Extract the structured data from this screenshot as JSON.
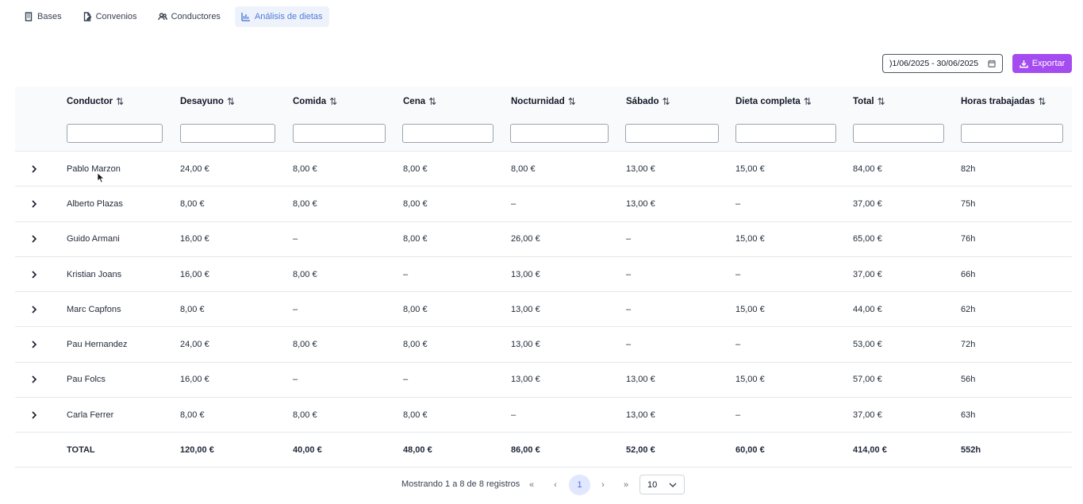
{
  "tabs": [
    {
      "label": "Bases",
      "icon": "building-icon",
      "active": false
    },
    {
      "label": "Convenios",
      "icon": "document-edit-icon",
      "active": false
    },
    {
      "label": "Conductores",
      "icon": "users-icon",
      "active": false
    },
    {
      "label": "Análisis de dietas",
      "icon": "bar-chart-icon",
      "active": true
    }
  ],
  "toolbar": {
    "date_range": ")1/06/2025 - 30/06/2025",
    "export_label": "Exportar",
    "accent_color": "#a54cf0"
  },
  "table": {
    "columns": [
      "Conductor",
      "Desayuno",
      "Comida",
      "Cena",
      "Nocturnidad",
      "Sábado",
      "Dieta completa",
      "Total",
      "Horas trabajadas"
    ],
    "sort_icon": "⇅",
    "rows": [
      [
        "Pablo Marzon",
        "24,00 €",
        "8,00 €",
        "8,00 €",
        "8,00 €",
        "13,00 €",
        "15,00 €",
        "84,00 €",
        "82h"
      ],
      [
        "Alberto Plazas",
        "8,00 €",
        "8,00 €",
        "8,00 €",
        "–",
        "13,00 €",
        "–",
        "37,00 €",
        "75h"
      ],
      [
        "Guido Armani",
        "16,00 €",
        "–",
        "8,00 €",
        "26,00 €",
        "–",
        "15,00 €",
        "65,00 €",
        "76h"
      ],
      [
        "Kristian Joans",
        "16,00 €",
        "8,00 €",
        "–",
        "13,00 €",
        "–",
        "–",
        "37,00 €",
        "66h"
      ],
      [
        "Marc Capfons",
        "8,00 €",
        "–",
        "8,00 €",
        "13,00 €",
        "–",
        "15,00 €",
        "44,00 €",
        "62h"
      ],
      [
        "Pau Hernandez",
        "24,00 €",
        "8,00 €",
        "8,00 €",
        "13,00 €",
        "–",
        "–",
        "53,00 €",
        "72h"
      ],
      [
        "Pau Folcs",
        "16,00 €",
        "–",
        "–",
        "13,00 €",
        "13,00 €",
        "15,00 €",
        "57,00 €",
        "56h"
      ],
      [
        "Carla Ferrer",
        "8,00 €",
        "8,00 €",
        "8,00 €",
        "–",
        "13,00 €",
        "–",
        "37,00 €",
        "63h"
      ]
    ],
    "totals": [
      "TOTAL",
      "120,00 €",
      "40,00 €",
      "48,00 €",
      "86,00 €",
      "52,00 €",
      "60,00 €",
      "414,00 €",
      "552h"
    ]
  },
  "pagination": {
    "info": "Mostrando 1 a 8 de 8 registros",
    "first": "«",
    "prev": "‹",
    "current_page": "1",
    "next": "›",
    "last": "»",
    "page_size": "10"
  }
}
